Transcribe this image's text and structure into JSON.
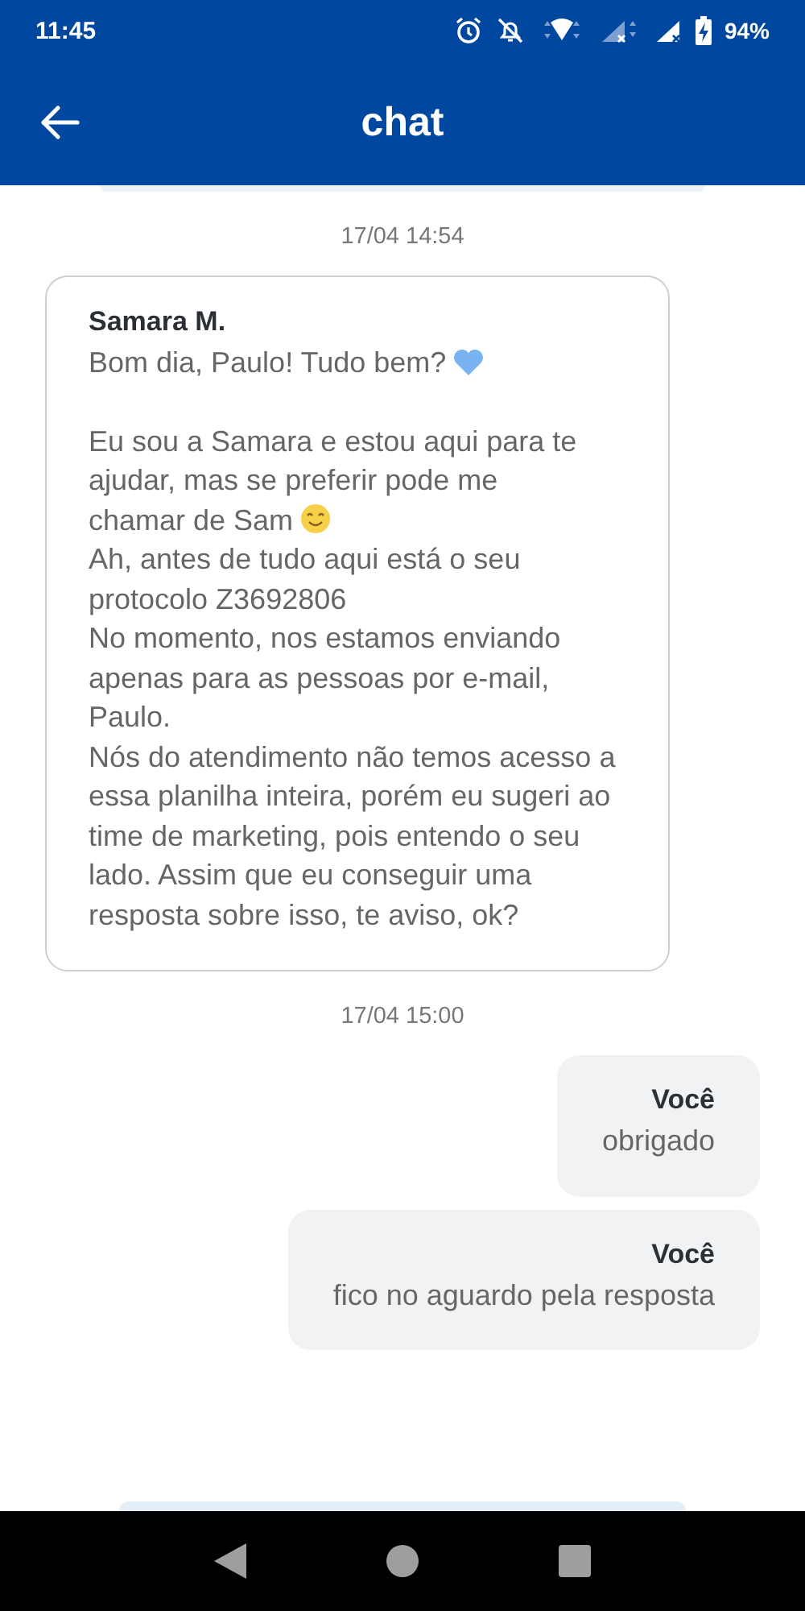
{
  "status_bar": {
    "time": "11:45",
    "battery": "94%"
  },
  "app_bar": {
    "title": "chat"
  },
  "messages": [
    {
      "kind": "date",
      "text": "17/04 14:54"
    },
    {
      "kind": "incoming",
      "author": "Samara M.",
      "paragraphs": [
        [
          {
            "kind": "heart",
            "text": "Bom dia, Paulo! Tudo bem?"
          }
        ],
        [
          {
            "kind": "plain",
            "text": "Eu sou a Samara e estou aqui para te ajudar, mas se preferir pode me"
          },
          {
            "kind": "smile",
            "text": "chamar de Sam"
          },
          {
            "kind": "plain",
            "text": "Ah, antes de tudo aqui está o seu protocolo Z3692806"
          },
          {
            "text": "No momento, nos estamos enviando apenas para as pessoas por e-mail, Paulo."
          },
          {
            "text": "Nós do atendimento não temos acesso a essa planilha inteira, porém eu sugeri ao time de marketing, pois entendo o seu lado. Assim que eu conseguir uma resposta sobre isso, te aviso, ok?"
          }
        ]
      ]
    },
    {
      "kind": "date",
      "text": "17/04 15:00"
    },
    {
      "kind": "outgoing",
      "author": "Você",
      "paragraphs": [
        [
          {
            "text": "obrigado"
          }
        ]
      ]
    },
    {
      "kind": "outgoing",
      "author": "Você",
      "paragraphs": [
        [
          {
            "text": "fico no aguardo pela resposta"
          }
        ]
      ]
    }
  ]
}
